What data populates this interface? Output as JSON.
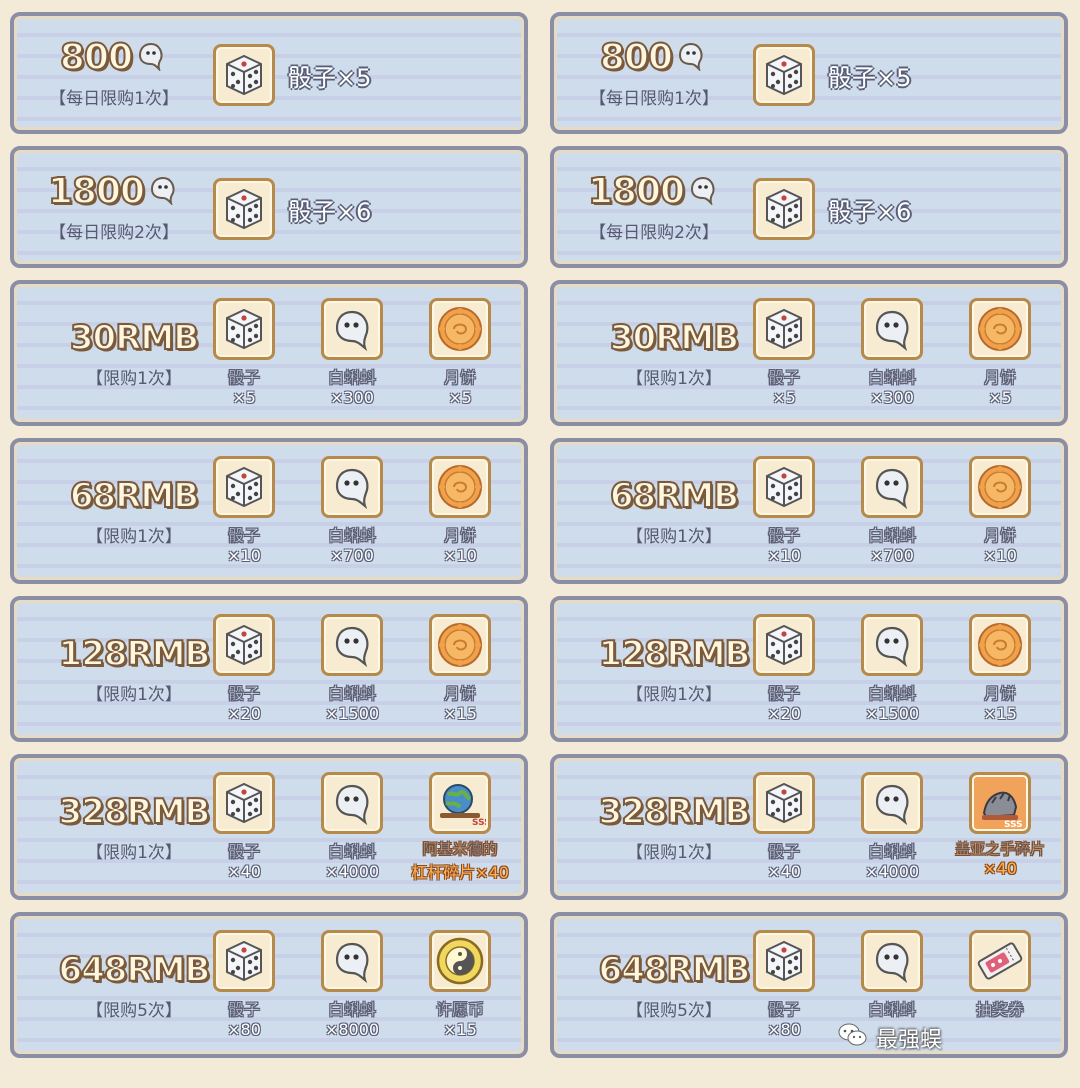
{
  "columns": [
    {
      "offers": [
        {
          "price": "800",
          "limit": "【每日限购1次】",
          "currency_icon": "bubble-icon",
          "items": [
            {
              "icon": "dice-icon",
              "label": "骰子×5"
            }
          ]
        },
        {
          "price": "1800",
          "limit": "【每日限购2次】",
          "currency_icon": "bubble-icon",
          "items": [
            {
              "icon": "dice-icon",
              "label": "骰子×6"
            }
          ]
        },
        {
          "price": "30RMB",
          "limit": "【限购1次】",
          "items": [
            {
              "icon": "dice-icon",
              "name": "骰子",
              "qty": "×5"
            },
            {
              "icon": "tadpole-icon",
              "name": "白蝌蚪",
              "qty": "×300"
            },
            {
              "icon": "mooncake-icon",
              "name": "月饼",
              "qty": "×5"
            }
          ]
        },
        {
          "price": "68RMB",
          "limit": "【限购1次】",
          "items": [
            {
              "icon": "dice-icon",
              "name": "骰子",
              "qty": "×10"
            },
            {
              "icon": "tadpole-icon",
              "name": "白蝌蚪",
              "qty": "×700"
            },
            {
              "icon": "mooncake-icon",
              "name": "月饼",
              "qty": "×10"
            }
          ]
        },
        {
          "price": "128RMB",
          "limit": "【限购1次】",
          "items": [
            {
              "icon": "dice-icon",
              "name": "骰子",
              "qty": "×20"
            },
            {
              "icon": "tadpole-icon",
              "name": "白蝌蚪",
              "qty": "×1500"
            },
            {
              "icon": "mooncake-icon",
              "name": "月饼",
              "qty": "×15"
            }
          ]
        },
        {
          "price": "328RMB",
          "limit": "【限购1次】",
          "items": [
            {
              "icon": "dice-icon",
              "name": "骰子",
              "qty": "×40"
            },
            {
              "icon": "tadpole-icon",
              "name": "白蝌蚪",
              "qty": "×4000"
            },
            {
              "icon": "archimedes-lever-fragment-icon",
              "name": "阿基米德的",
              "qty": "杠杆碎片×40",
              "special": true
            }
          ]
        },
        {
          "price": "648RMB",
          "limit": "【限购5次】",
          "items": [
            {
              "icon": "dice-icon",
              "name": "骰子",
              "qty": "×80"
            },
            {
              "icon": "tadpole-icon",
              "name": "白蝌蚪",
              "qty": "×8000"
            },
            {
              "icon": "wish-coin-icon",
              "name": "许愿币",
              "qty": "×15"
            }
          ]
        }
      ]
    },
    {
      "offers": [
        {
          "price": "800",
          "limit": "【每日限购1次】",
          "currency_icon": "bubble-icon",
          "items": [
            {
              "icon": "dice-icon",
              "label": "骰子×5"
            }
          ]
        },
        {
          "price": "1800",
          "limit": "【每日限购2次】",
          "currency_icon": "bubble-icon",
          "items": [
            {
              "icon": "dice-icon",
              "label": "骰子×6"
            }
          ]
        },
        {
          "price": "30RMB",
          "limit": "【限购1次】",
          "items": [
            {
              "icon": "dice-icon",
              "name": "骰子",
              "qty": "×5"
            },
            {
              "icon": "tadpole-icon",
              "name": "白蝌蚪",
              "qty": "×300"
            },
            {
              "icon": "mooncake-icon",
              "name": "月饼",
              "qty": "×5"
            }
          ]
        },
        {
          "price": "68RMB",
          "limit": "【限购1次】",
          "items": [
            {
              "icon": "dice-icon",
              "name": "骰子",
              "qty": "×10"
            },
            {
              "icon": "tadpole-icon",
              "name": "白蝌蚪",
              "qty": "×700"
            },
            {
              "icon": "mooncake-icon",
              "name": "月饼",
              "qty": "×10"
            }
          ]
        },
        {
          "price": "128RMB",
          "limit": "【限购1次】",
          "items": [
            {
              "icon": "dice-icon",
              "name": "骰子",
              "qty": "×20"
            },
            {
              "icon": "tadpole-icon",
              "name": "白蝌蚪",
              "qty": "×1500"
            },
            {
              "icon": "mooncake-icon",
              "name": "月饼",
              "qty": "×15"
            }
          ]
        },
        {
          "price": "328RMB",
          "limit": "【限购1次】",
          "items": [
            {
              "icon": "dice-icon",
              "name": "骰子",
              "qty": "×40"
            },
            {
              "icon": "tadpole-icon",
              "name": "白蝌蚪",
              "qty": "×4000"
            },
            {
              "icon": "gaia-hand-fragment-icon",
              "name": "盖亚之手碎片",
              "qty": "×40",
              "special": true
            }
          ]
        },
        {
          "price": "648RMB",
          "limit": "【限购5次】",
          "items": [
            {
              "icon": "dice-icon",
              "name": "骰子",
              "qty": "×80"
            },
            {
              "icon": "tadpole-icon",
              "name": "白蝌蚪",
              "qty": ""
            },
            {
              "icon": "lottery-ticket-icon",
              "name": "抽奖券",
              "qty": ""
            }
          ]
        }
      ]
    }
  ],
  "watermark": {
    "text": "最强蜈",
    "icon": "wechat-icon"
  },
  "colors": {
    "card_bg": "#cfdceb",
    "card_border": "#8a8fa5",
    "special_text": "#ffb056",
    "page_bg": "#f3ead8"
  }
}
